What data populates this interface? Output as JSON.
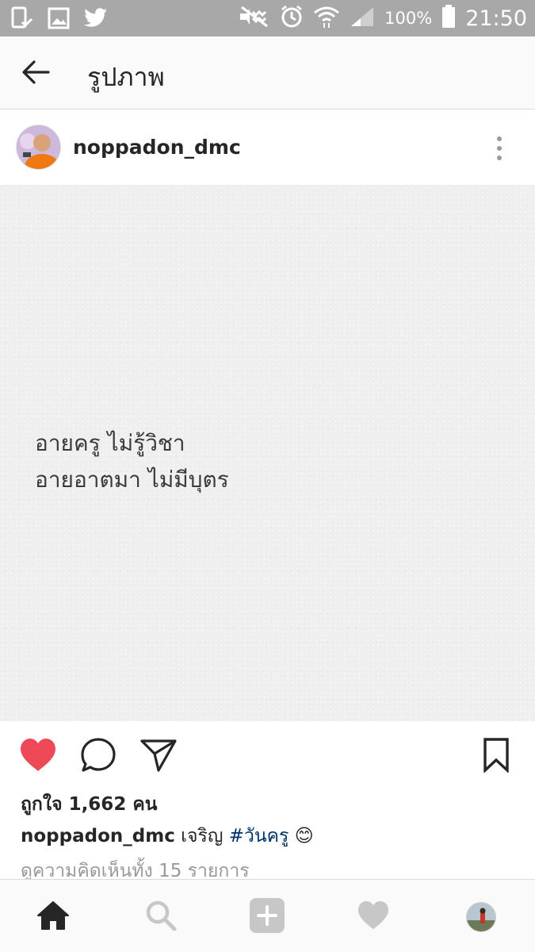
{
  "status_bar": {
    "battery_percent": "100%",
    "time": "21:50",
    "left_icons": [
      "device-check-icon",
      "image-icon",
      "twitter-icon"
    ],
    "right_icons": [
      "mute-icon",
      "alarm-icon",
      "wifi-icon",
      "signal-icon",
      "battery-icon"
    ]
  },
  "app_bar": {
    "title": "รูปภาพ",
    "back_icon": "arrow-left-icon"
  },
  "post": {
    "username": "noppadon_dmc",
    "image_text": [
      "อายครู ไม่รู้วิชา",
      "อายอาตมา ไม่มีบุตร"
    ],
    "liked": true,
    "likes_text": "ถูกใจ 1,662 คน",
    "caption_user": "noppadon_dmc",
    "caption_text": "เจริญ",
    "caption_hashtag": "#วันครู",
    "caption_emoji": "😊",
    "comments_link": "ดูความคิดเห็นทั้ง 15 รายการ"
  },
  "actions": [
    "heart-icon",
    "comment-icon",
    "share-icon",
    "bookmark-icon"
  ],
  "bottom_nav": [
    "home-icon",
    "search-icon",
    "add-post-icon",
    "activity-heart-icon",
    "profile-avatar"
  ],
  "colors": {
    "status_bar": "#a8a8a8",
    "like_red": "#ed4956",
    "hashtag": "#003569",
    "muted_text": "#999999"
  }
}
